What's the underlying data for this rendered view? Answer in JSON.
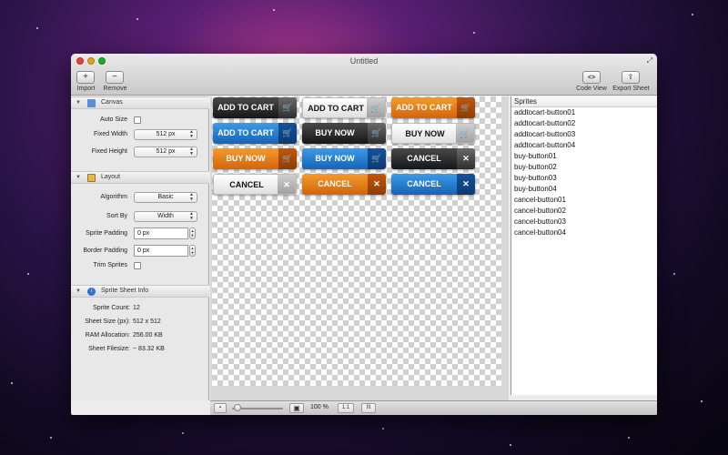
{
  "window": {
    "title": "Untitled"
  },
  "toolbar": {
    "import_label": "Import",
    "remove_label": "Remove",
    "code_view_label": "Code View",
    "export_sheet_label": "Export Sheet"
  },
  "sidebar": {
    "canvas": {
      "title": "Canvas",
      "auto_size_label": "Auto Size",
      "fixed_width_label": "Fixed Width",
      "fixed_width_value": "512 px",
      "fixed_height_label": "Fixed Height",
      "fixed_height_value": "512 px"
    },
    "layout": {
      "title": "Layout",
      "algorithm_label": "Algorithm",
      "algorithm_value": "Basic",
      "sort_by_label": "Sort By",
      "sort_by_value": "Width",
      "sprite_padding_label": "Sprite Padding",
      "sprite_padding_value": "0 px",
      "border_padding_label": "Border Padding",
      "border_padding_value": "0 px",
      "trim_sprites_label": "Trim Sprites"
    },
    "info": {
      "title": "Sprite Sheet Info",
      "sprite_count_label": "Sprite Count:",
      "sprite_count_value": "12",
      "sheet_size_label": "Sheet Size (px):",
      "sheet_size_value": "512 x 512",
      "ram_label": "RAM Allocation:",
      "ram_value": "256.00 KB",
      "filesize_label": "Sheet Filesize:",
      "filesize_value": "~ 83.32 KB"
    }
  },
  "sprites": [
    {
      "label": "ADD TO CART",
      "style": "black",
      "icon": "cart-icon"
    },
    {
      "label": "ADD TO CART",
      "style": "white",
      "icon": "cart-icon"
    },
    {
      "label": "ADD TO CART",
      "style": "orange",
      "icon": "cart-icon"
    },
    {
      "label": "ADD TO CART",
      "style": "blue",
      "icon": "cart-icon"
    },
    {
      "label": "BUY NOW",
      "style": "black",
      "icon": "cart-icon"
    },
    {
      "label": "BUY NOW",
      "style": "white",
      "icon": "cart-icon"
    },
    {
      "label": "BUY NOW",
      "style": "orange",
      "icon": "cart-icon"
    },
    {
      "label": "BUY NOW",
      "style": "blue",
      "icon": "cart-icon"
    },
    {
      "label": "CANCEL",
      "style": "black",
      "icon": "x-icon"
    },
    {
      "label": "CANCEL",
      "style": "white",
      "icon": "x-icon"
    },
    {
      "label": "CANCEL",
      "style": "orange",
      "icon": "x-icon"
    },
    {
      "label": "CANCEL",
      "style": "blue",
      "icon": "x-icon"
    }
  ],
  "sprites_list": {
    "header": "Sprites",
    "items": [
      "addtocart-button01",
      "addtocart-button02",
      "addtocart-button03",
      "addtocart-button04",
      "buy-button01",
      "buy-button02",
      "buy-button03",
      "buy-button04",
      "cancel-button01",
      "cancel-button02",
      "cancel-button03",
      "cancel-button04"
    ]
  },
  "bottombar": {
    "zoom_value": "100 %",
    "actual_size_label": "1:1",
    "fit_label": "fit",
    "zoom_level": 0.1
  },
  "colors": {
    "black": "#1e1e1e",
    "white": "#ffffff",
    "orange": "#e07a16",
    "blue": "#2178cf"
  }
}
